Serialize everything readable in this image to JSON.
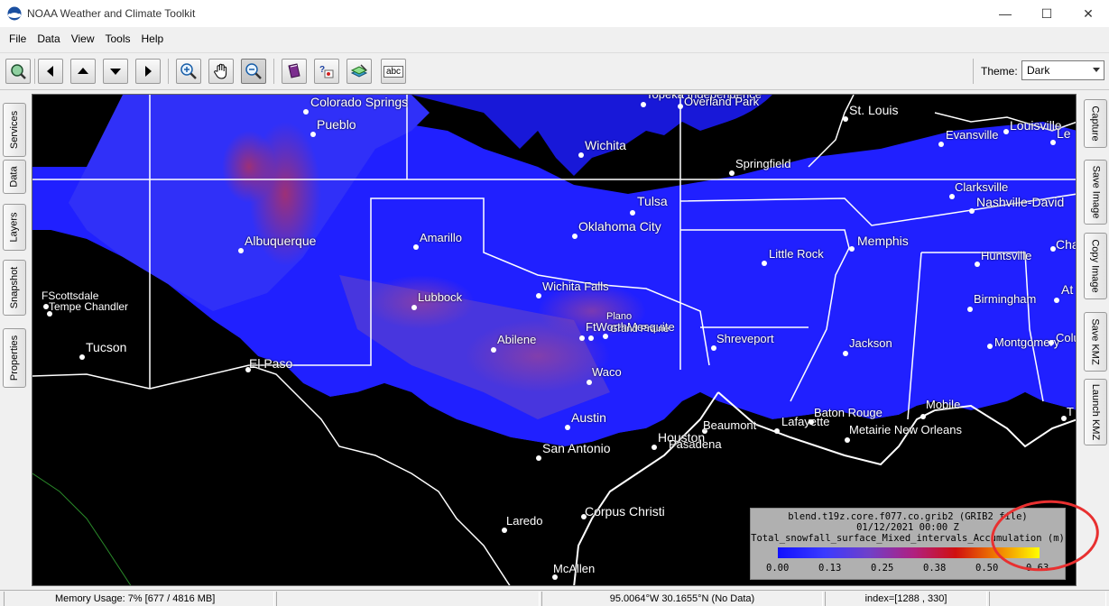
{
  "window": {
    "title": "NOAA Weather and Climate Toolkit",
    "minimize": "—",
    "maximize": "☐",
    "close": "✕"
  },
  "menu": {
    "file": "File",
    "data": "Data",
    "view": "View",
    "tools": "Tools",
    "help": "Help"
  },
  "toolbar": {
    "theme_label": "Theme:",
    "theme_value": "Dark",
    "abc_label": "abc"
  },
  "left_tabs": [
    "Services",
    "Data",
    "Layers",
    "Snapshot",
    "Properties"
  ],
  "right_tabs": [
    "Capture",
    "Save Image",
    "Copy Image",
    "Save KMZ",
    "Launch KMZ"
  ],
  "cities": {
    "colorado_springs": "Colorado Springs",
    "pueblo": "Pueblo",
    "wichita": "Wichita",
    "topeka": "Topeka Independence",
    "overland_park": "Overland Park",
    "st_louis": "St. Louis",
    "evansville": "Evansville",
    "louisville": "Louisville",
    "le": "Le",
    "springfield": "Springfield",
    "tulsa": "Tulsa",
    "oklahoma_city": "Oklahoma City",
    "clarksville": "Clarksville",
    "nashville": "Nashville-David",
    "albuquerque": "Albuquerque",
    "amarillo": "Amarillo",
    "memphis": "Memphis",
    "chattanooga": "Chattan",
    "little_rock": "Little Rock",
    "huntsville": "Huntsville",
    "scottsdale": "FScottsdale",
    "tempe": "Tempe Chandler",
    "lubbock": "Lubbock",
    "wichita_falls": "Wichita Falls",
    "birmingham": "Birmingham",
    "atlanta": "At",
    "dfw": "FtWorthMesquite",
    "plano": "Plano",
    "grand_prairie": "Grand Prairie",
    "tucson": "Tucson",
    "abilene": "Abilene",
    "shreveport": "Shreveport",
    "montgomery": "Montgomery",
    "columbus": "Colum",
    "jackson": "Jackson",
    "el_paso": "El Paso",
    "waco": "Waco",
    "austin": "Austin",
    "beaumont": "Beaumont",
    "lafayette": "Lafayette",
    "baton_rouge": "Baton Rouge",
    "mobile": "Mobile",
    "ta": "T",
    "san_antonio": "San Antonio",
    "houston": "Houston",
    "pasadena": "Pasadena",
    "metairie": "Metairie New Orleans",
    "laredo": "Laredo",
    "corpus_christi": "Corpus Christi",
    "mcallen": "McAllen"
  },
  "legend": {
    "file": "blend.t19z.core.f077.co.grib2 (GRIB2 file)",
    "time": "01/12/2021 00:00 Z",
    "variable": "Total_snowfall_surface_Mixed_intervals_Accumulation (m)",
    "ticks": [
      "0.00",
      "0.13",
      "0.25",
      "0.38",
      "0.50",
      "0.63"
    ],
    "colors": {
      "low": "#1010ff",
      "mid": "#b02080",
      "high": "#ffff00"
    }
  },
  "status": {
    "memory": "Memory Usage: 7% [677 / 4816 MB]",
    "coords": "95.0064°W 30.1655°N  (No Data)",
    "index": "index=[1288 , 330]"
  },
  "colors": {
    "snow_field": "#2020ff",
    "background_map": "#000000",
    "annotation": "#e83030"
  }
}
